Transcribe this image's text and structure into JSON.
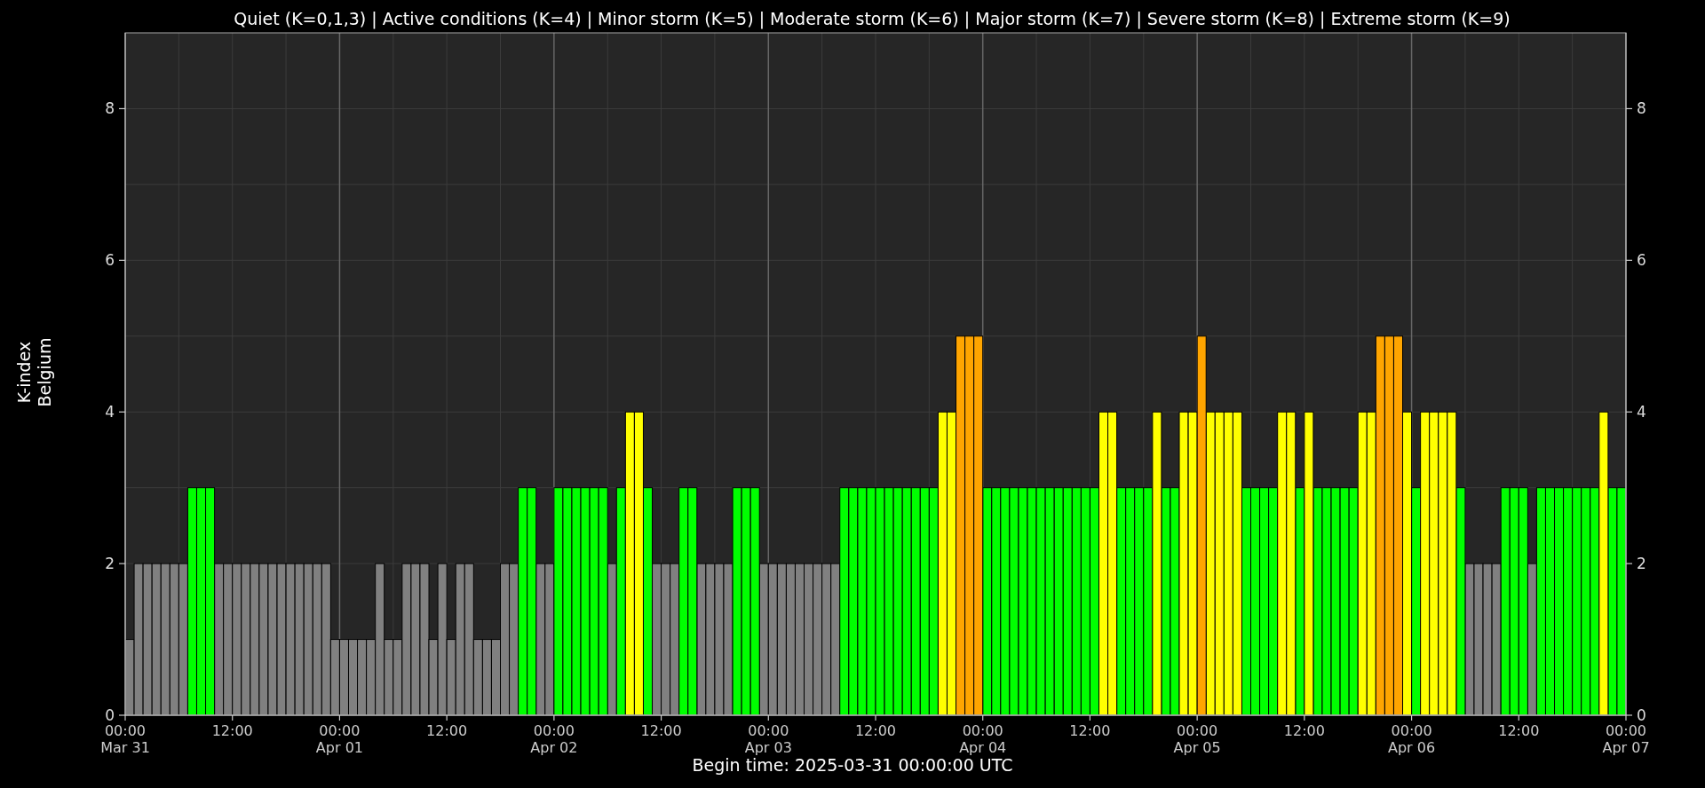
{
  "chart": {
    "chart_data": {
      "type": "bar",
      "title": "Quiet (K=0,1,3) | Active conditions (K=4) | Minor storm (K=5) | Moderate storm (K=6) | Major storm (K=7) | Severe storm (K=8) | Extreme storm (K=9)",
      "xlabel": "Begin time: 2025-03-31 00:00:00 UTC",
      "ylabel": "K-index\nBelgium",
      "categories": [
        "00:00\nMar 31",
        null,
        null,
        null,
        null,
        null,
        null,
        null,
        null,
        null,
        null,
        null,
        "12:00",
        null,
        null,
        null,
        null,
        null,
        null,
        null,
        null,
        null,
        null,
        null,
        "00:00\nApr 01",
        null,
        null,
        null,
        null,
        null,
        null,
        null,
        null,
        null,
        null,
        null,
        "12:00",
        null,
        null,
        null,
        null,
        null,
        null,
        null,
        null,
        null,
        null,
        null,
        "00:00\nApr 02",
        null,
        null,
        null,
        null,
        null,
        null,
        null,
        null,
        null,
        null,
        null,
        "12:00",
        null,
        null,
        null,
        null,
        null,
        null,
        null,
        null,
        null,
        null,
        null,
        "00:00\nApr 03",
        null,
        null,
        null,
        null,
        null,
        null,
        null,
        null,
        null,
        null,
        null,
        "12:00",
        null,
        null,
        null,
        null,
        null,
        null,
        null,
        null,
        null,
        null,
        null,
        "00:00\nApr 04",
        null,
        null,
        null,
        null,
        null,
        null,
        null,
        null,
        null,
        null,
        null,
        "12:00",
        null,
        null,
        null,
        null,
        null,
        null,
        null,
        null,
        null,
        null,
        null,
        "00:00\nApr 05",
        null,
        null,
        null,
        null,
        null,
        null,
        null,
        null,
        null,
        null,
        null,
        "12:00",
        null,
        null,
        null,
        null,
        null,
        null,
        null,
        null,
        null,
        null,
        null,
        "00:00\nApr 06",
        null,
        null,
        null,
        null,
        null,
        null,
        null,
        null,
        null,
        null,
        null,
        "12:00",
        null,
        null,
        null,
        null,
        null,
        null,
        null,
        null,
        null,
        null,
        null,
        "00:00\nApr 07"
      ],
      "series": [
        {
          "color": "#808080",
          "values": [
            1,
            2,
            2,
            2,
            2,
            2,
            2,
            null,
            null,
            null,
            2,
            2,
            2,
            2,
            2,
            2,
            2,
            2,
            2,
            2,
            2,
            2,
            2,
            1,
            1,
            1,
            1,
            1,
            2,
            1,
            1,
            2,
            2,
            2,
            1,
            2,
            1,
            2,
            2,
            1,
            1,
            1,
            2,
            2,
            null,
            null,
            2,
            2,
            null,
            null,
            null,
            null,
            null,
            null,
            2,
            null,
            null,
            null,
            null,
            2,
            2,
            2,
            null,
            null,
            2,
            2,
            2,
            2,
            null,
            null,
            null,
            2,
            2,
            2,
            2,
            2,
            2,
            2,
            2,
            2,
            null,
            null,
            null,
            null,
            null,
            null,
            null,
            null,
            null,
            null,
            null,
            null,
            null,
            null,
            null,
            null,
            null,
            null,
            null,
            null,
            null,
            null,
            null,
            null,
            null,
            null,
            null,
            null,
            null,
            null,
            null,
            null,
            null,
            null,
            null,
            null,
            null,
            null,
            null,
            null,
            null,
            null,
            null,
            null,
            null,
            null,
            null,
            null,
            null,
            null,
            null,
            null,
            null,
            null,
            null,
            null,
            null,
            null,
            null,
            null,
            null,
            null,
            null,
            null,
            null,
            null,
            null,
            null,
            null,
            null,
            2,
            2,
            2,
            2,
            null,
            null,
            null,
            2,
            null,
            null,
            null,
            null,
            null,
            null,
            null,
            null,
            null,
            null,
            null
          ]
        },
        {
          "color": "#00ff00",
          "values": [
            null,
            null,
            null,
            null,
            null,
            null,
            null,
            3,
            3,
            3,
            null,
            null,
            null,
            null,
            null,
            null,
            null,
            null,
            null,
            null,
            null,
            null,
            null,
            null,
            null,
            null,
            null,
            null,
            null,
            null,
            null,
            null,
            null,
            null,
            null,
            null,
            null,
            null,
            null,
            null,
            null,
            null,
            null,
            null,
            3,
            3,
            null,
            null,
            3,
            3,
            3,
            3,
            3,
            3,
            null,
            3,
            null,
            null,
            3,
            null,
            null,
            null,
            3,
            3,
            null,
            null,
            null,
            null,
            3,
            3,
            3,
            null,
            null,
            null,
            null,
            null,
            null,
            null,
            null,
            null,
            3,
            3,
            3,
            3,
            3,
            3,
            3,
            3,
            3,
            3,
            3,
            null,
            null,
            null,
            null,
            null,
            3,
            3,
            3,
            3,
            3,
            3,
            3,
            3,
            3,
            3,
            3,
            3,
            3,
            null,
            null,
            3,
            3,
            3,
            3,
            null,
            3,
            3,
            null,
            null,
            null,
            null,
            null,
            null,
            null,
            3,
            3,
            3,
            3,
            null,
            null,
            3,
            null,
            3,
            3,
            3,
            3,
            3,
            null,
            null,
            null,
            null,
            null,
            null,
            3,
            null,
            null,
            null,
            null,
            3,
            null,
            null,
            null,
            null,
            3,
            3,
            3,
            null,
            3,
            3,
            3,
            3,
            3,
            3,
            3,
            null,
            3,
            3,
            null
          ]
        },
        {
          "color": "#ffff00",
          "values": [
            null,
            null,
            null,
            null,
            null,
            null,
            null,
            null,
            null,
            null,
            null,
            null,
            null,
            null,
            null,
            null,
            null,
            null,
            null,
            null,
            null,
            null,
            null,
            null,
            null,
            null,
            null,
            null,
            null,
            null,
            null,
            null,
            null,
            null,
            null,
            null,
            null,
            null,
            null,
            null,
            null,
            null,
            null,
            null,
            null,
            null,
            null,
            null,
            null,
            null,
            null,
            null,
            null,
            null,
            null,
            null,
            4,
            4,
            null,
            null,
            null,
            null,
            null,
            null,
            null,
            null,
            null,
            null,
            null,
            null,
            null,
            null,
            null,
            null,
            null,
            null,
            null,
            null,
            null,
            null,
            null,
            null,
            null,
            null,
            null,
            null,
            null,
            null,
            null,
            null,
            null,
            4,
            4,
            null,
            null,
            null,
            null,
            null,
            null,
            null,
            null,
            null,
            null,
            null,
            null,
            null,
            null,
            null,
            null,
            4,
            4,
            null,
            null,
            null,
            null,
            4,
            null,
            null,
            4,
            4,
            null,
            4,
            4,
            4,
            4,
            null,
            null,
            null,
            null,
            4,
            4,
            null,
            4,
            null,
            null,
            null,
            null,
            null,
            4,
            4,
            null,
            null,
            null,
            4,
            null,
            4,
            4,
            4,
            4,
            null,
            null,
            null,
            null,
            null,
            null,
            null,
            null,
            null,
            null,
            null,
            null,
            null,
            null,
            null,
            null,
            4,
            null,
            null,
            null
          ]
        },
        {
          "color": "#ffa500",
          "values": [
            null,
            null,
            null,
            null,
            null,
            null,
            null,
            null,
            null,
            null,
            null,
            null,
            null,
            null,
            null,
            null,
            null,
            null,
            null,
            null,
            null,
            null,
            null,
            null,
            null,
            null,
            null,
            null,
            null,
            null,
            null,
            null,
            null,
            null,
            null,
            null,
            null,
            null,
            null,
            null,
            null,
            null,
            null,
            null,
            null,
            null,
            null,
            null,
            null,
            null,
            null,
            null,
            null,
            null,
            null,
            null,
            null,
            null,
            null,
            null,
            null,
            null,
            null,
            null,
            null,
            null,
            null,
            null,
            null,
            null,
            null,
            null,
            null,
            null,
            null,
            null,
            null,
            null,
            null,
            null,
            null,
            null,
            null,
            null,
            null,
            null,
            null,
            null,
            null,
            null,
            null,
            null,
            null,
            5,
            5,
            5,
            null,
            null,
            null,
            null,
            null,
            null,
            null,
            null,
            null,
            null,
            null,
            null,
            null,
            null,
            null,
            null,
            null,
            null,
            null,
            null,
            null,
            null,
            null,
            null,
            5,
            null,
            null,
            null,
            null,
            null,
            null,
            null,
            null,
            null,
            null,
            null,
            null,
            null,
            null,
            null,
            null,
            null,
            null,
            null,
            5,
            5,
            5,
            null,
            null,
            null,
            null,
            null,
            null,
            null,
            null,
            null,
            null,
            null,
            null,
            null,
            null,
            null,
            null,
            null,
            null,
            null,
            null,
            null,
            null,
            null,
            null,
            null,
            null
          ]
        }
      ],
      "ylim": [
        0,
        9
      ],
      "yticks": [
        0,
        2,
        4,
        6,
        8
      ],
      "y2lim": [
        0,
        9
      ],
      "y2ticks": [
        0,
        2,
        4,
        6,
        8
      ],
      "grid": true
    }
  }
}
